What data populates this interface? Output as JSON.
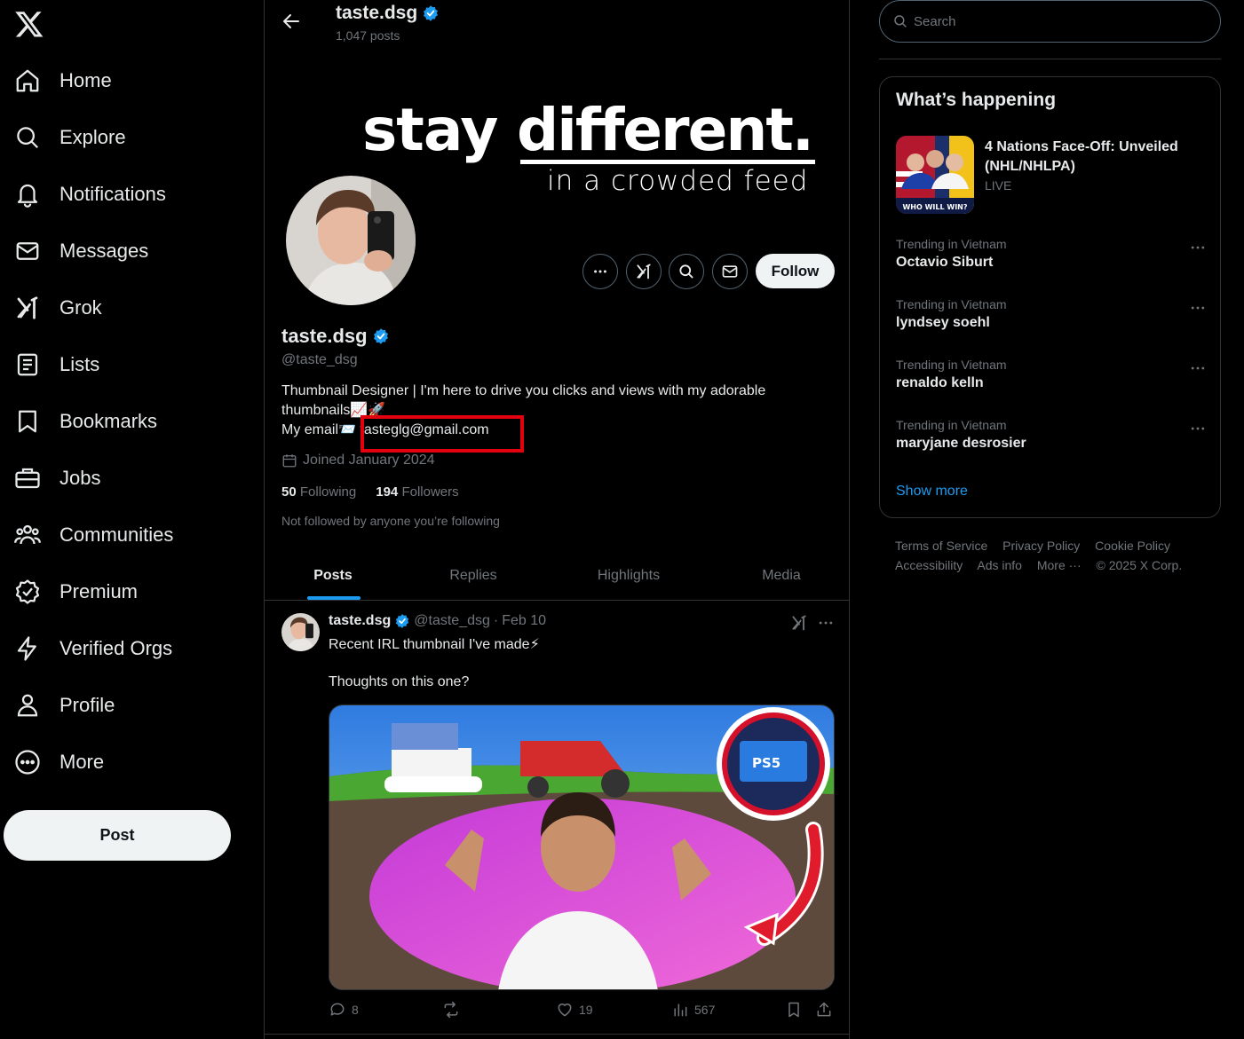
{
  "nav": {
    "items": [
      {
        "label": "Home",
        "icon": "home-icon"
      },
      {
        "label": "Explore",
        "icon": "search-icon"
      },
      {
        "label": "Notifications",
        "icon": "bell-icon"
      },
      {
        "label": "Messages",
        "icon": "envelope-icon"
      },
      {
        "label": "Grok",
        "icon": "grok-icon"
      },
      {
        "label": "Lists",
        "icon": "list-icon"
      },
      {
        "label": "Bookmarks",
        "icon": "bookmark-icon"
      },
      {
        "label": "Jobs",
        "icon": "briefcase-icon"
      },
      {
        "label": "Communities",
        "icon": "people-icon"
      },
      {
        "label": "Premium",
        "icon": "premium-icon"
      },
      {
        "label": "Verified Orgs",
        "icon": "lightning-icon"
      },
      {
        "label": "Profile",
        "icon": "person-icon"
      },
      {
        "label": "More",
        "icon": "more-circle-icon"
      }
    ],
    "post_label": "Post"
  },
  "header": {
    "name": "taste.dsg",
    "post_count": "1,047 posts"
  },
  "banner": {
    "word1": "stay",
    "word2": "different.",
    "subtitle": "in a crowded feed"
  },
  "profile": {
    "name": "taste.dsg",
    "handle": "@taste_dsg",
    "bio_line1": "Thumbnail Designer | I'm here to drive you clicks and views with my adorable thumbnails📈🚀",
    "bio_email_prefix": "My email📨 ",
    "bio_email": "tasteglg@gmail.com",
    "joined": "Joined January 2024",
    "following_count": "50",
    "following_label": "Following",
    "followers_count": "194",
    "followers_label": "Followers",
    "not_followed": "Not followed by anyone you’re following",
    "follow_label": "Follow"
  },
  "tabs": [
    "Posts",
    "Replies",
    "Highlights",
    "Media"
  ],
  "tweet": {
    "name": "taste.dsg",
    "handle": "@taste_dsg",
    "sep": "·",
    "date": "Feb 10",
    "text1": "Recent IRL thumbnail I've made⚡",
    "text2": "Thoughts on this one?",
    "media_text": "PS5",
    "replies": "8",
    "likes": "19",
    "views": "567"
  },
  "right": {
    "search_placeholder": "Search",
    "trends_title": "What’s happening",
    "event": {
      "title": "4 Nations Face-Off: Unveiled (NHL/NHLPA)",
      "status": "LIVE",
      "image_text": "WHO WILL WIN?"
    },
    "trends": [
      {
        "context": "Trending in Vietnam",
        "name": "Octavio Siburt"
      },
      {
        "context": "Trending in Vietnam",
        "name": "lyndsey soehl"
      },
      {
        "context": "Trending in Vietnam",
        "name": "renaldo kelln"
      },
      {
        "context": "Trending in Vietnam",
        "name": "maryjane desrosier"
      }
    ],
    "show_more": "Show more",
    "footer": [
      "Terms of Service",
      "Privacy Policy",
      "Cookie Policy",
      "Accessibility",
      "Ads info",
      "More ···",
      "© 2025 X Corp."
    ]
  },
  "colors": {
    "accent": "#1d9bf0",
    "highlight_box": "#e3000f",
    "border": "#2f3336",
    "muted": "#71767b"
  }
}
